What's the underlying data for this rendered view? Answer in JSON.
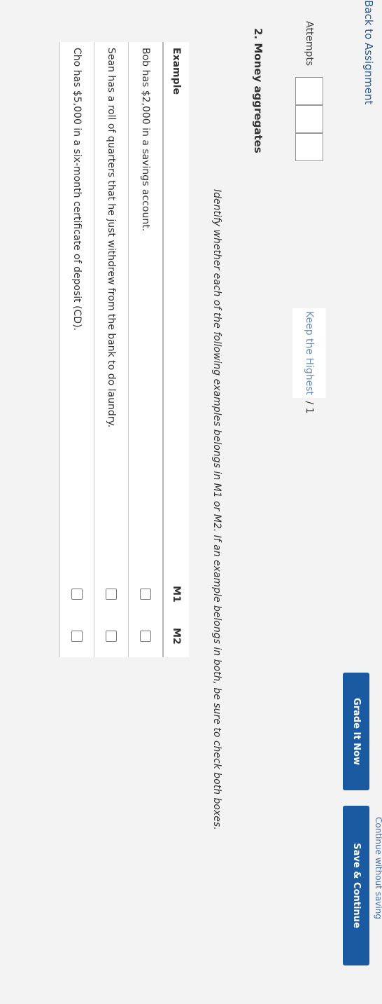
{
  "nav": {
    "back_label": "Back to Assignment"
  },
  "attempts": {
    "label": "Attempts",
    "boxes": [
      "",
      "",
      ""
    ],
    "keep_label": "Keep the Highest",
    "keep_suffix": " / 1"
  },
  "question": {
    "title": "2. Money aggregates",
    "instructions": "Identify whether each of the following examples belongs in M1 or M2. If an example belongs in both, be sure to check both boxes."
  },
  "table": {
    "headers": {
      "example": "Example",
      "m1": "M1",
      "m2": "M2"
    },
    "rows": [
      {
        "example": "Bob has $2,000 in a savings account.",
        "m1": false,
        "m2": false
      },
      {
        "example": "Sean has a roll of quarters that he just withdrew from the bank to do laundry.",
        "m1": false,
        "m2": false
      },
      {
        "example": "Cho has $5,000 in a six-month certificate of deposit (CD).",
        "m1": false,
        "m2": false
      }
    ]
  },
  "actions": {
    "grade_label": "Grade It Now",
    "save_label": "Save & Continue",
    "continue_label": "Continue without saving"
  },
  "colors": {
    "button": "#1a5aa0",
    "link": "#3c6fb0"
  }
}
